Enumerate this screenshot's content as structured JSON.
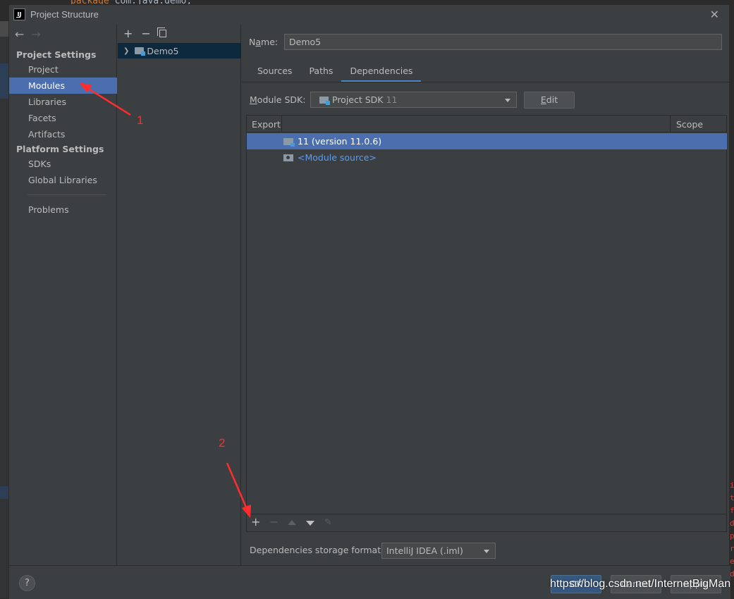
{
  "background": {
    "code_keyword": "package",
    "code_rest": " com.java.demo;",
    "right_strip_chars": [
      "i",
      "t",
      "f",
      "d",
      "p",
      "r",
      "e",
      "d"
    ]
  },
  "dialog": {
    "logo_text": "IJ",
    "title": "Project Structure",
    "close_glyph": "✕"
  },
  "sidebar": {
    "back_glyph": "←",
    "forward_glyph": "→",
    "project_settings_header": "Project Settings",
    "project_items": [
      {
        "label": "Project",
        "selected": false
      },
      {
        "label": "Modules",
        "selected": true
      },
      {
        "label": "Libraries",
        "selected": false
      },
      {
        "label": "Facets",
        "selected": false
      },
      {
        "label": "Artifacts",
        "selected": false
      }
    ],
    "platform_settings_header": "Platform Settings",
    "platform_items": [
      {
        "label": "SDKs"
      },
      {
        "label": "Global Libraries"
      }
    ],
    "problems_label": "Problems"
  },
  "modules": {
    "add_glyph": "+",
    "remove_glyph": "−",
    "tree": [
      {
        "label": "Demo5",
        "expanded": false
      }
    ]
  },
  "main": {
    "name_label_prefix": "N",
    "name_label_underlined": "a",
    "name_label_suffix": "me:",
    "name_value": "Demo5",
    "tabs": [
      {
        "label": "Sources",
        "active": false
      },
      {
        "label": "Paths",
        "active": false
      },
      {
        "label": "Dependencies",
        "active": true
      }
    ],
    "sdk_label_underlined": "M",
    "sdk_label_rest": "odule SDK:",
    "sdk_value": "Project SDK",
    "sdk_version": "11",
    "edit_underlined": "E",
    "edit_rest": "dit",
    "table": {
      "col_export": "Export",
      "col_scope": "Scope",
      "rows": [
        {
          "label": "11 (version 11.0.6)",
          "selected": true
        },
        {
          "label": "<Module source>",
          "selected": false
        }
      ]
    },
    "toolbar": {
      "add": "+",
      "remove": "−",
      "edit": "✎"
    },
    "storage_label": "Dependencies storage format:",
    "storage_value": "IntelliJ IDEA (.iml)"
  },
  "footer": {
    "help": "?",
    "ok": "OK",
    "cancel": "Cancel",
    "apply": "Apply"
  },
  "annotations": {
    "label1": "1",
    "label2": "2",
    "color": "#ff2d2d"
  },
  "watermark": "https://blog.csdn.net/InternetBigMan"
}
